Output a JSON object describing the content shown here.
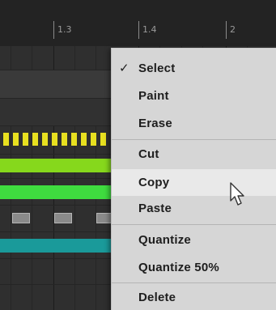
{
  "ruler": {
    "marks": [
      "1.3",
      "1.4",
      "2"
    ]
  },
  "menu": {
    "checkmark": "✓",
    "items": [
      {
        "label": "Select",
        "checked": true
      },
      {
        "label": "Paint"
      },
      {
        "label": "Erase"
      },
      {
        "label": "Cut"
      },
      {
        "label": "Copy",
        "hover": true
      },
      {
        "label": "Paste"
      },
      {
        "label": "Quantize"
      },
      {
        "label": "Quantize 50%"
      },
      {
        "label": "Delete"
      }
    ]
  },
  "colors": {
    "clip_yellow": "#e8e020",
    "clip_green": "#86d81c",
    "clip_bright_green": "#3fdc3f",
    "clip_teal": "#1a9a9a",
    "clip_gray": "#8a8a8a",
    "menu_bg": "#d6d6d6",
    "menu_hover": "#e9e9e9"
  },
  "cursor": {
    "icon": "arrow-pointer-icon"
  }
}
